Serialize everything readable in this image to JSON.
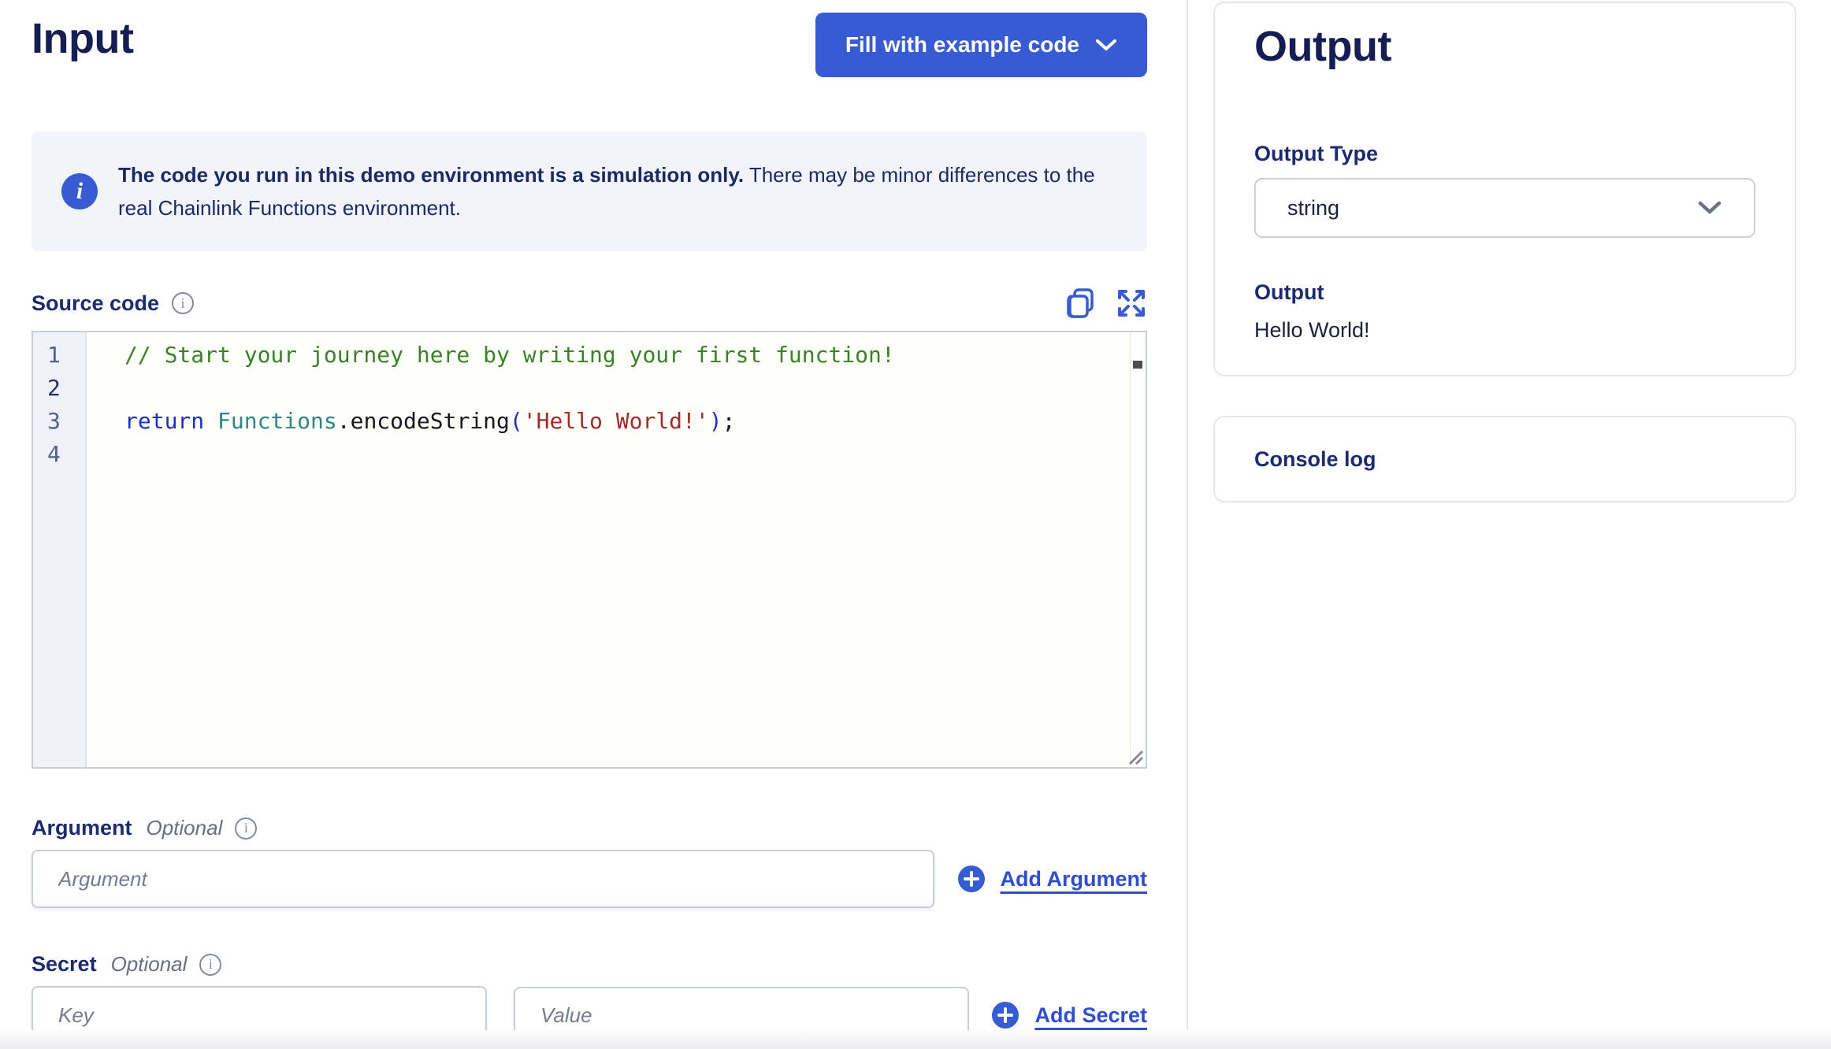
{
  "colors": {
    "accent_blue": "#375BD2",
    "link_blue": "#2E4DD0",
    "heading_navy": "#161D52",
    "label_navy": "#1C2A6E",
    "banner_bg": "#F2F4FA",
    "code_token_colors": {
      "comment": "#3C802B",
      "keyword": "#1E2FC5",
      "type": "#2E8587",
      "plain": "#16161F",
      "string": "#A32A2A"
    },
    "line_number": "#51608C",
    "line_number_active": "#24305F"
  },
  "icons": {
    "banner_info": "info-icon",
    "copy": "copy-icon",
    "expand": "expand-icon",
    "chevron": "chevron-down-icon",
    "plus": "plus-icon",
    "resize": "resize-handle-icon"
  },
  "input_panel": {
    "title": "Input",
    "fill_button_label": "Fill with example code",
    "banner": {
      "bold_text": "The code you run in this demo environment is a simulation only.",
      "regular_text": "There may be minor differences to the real Chainlink Functions environment."
    },
    "source_code": {
      "label": "Source code",
      "active_line": 2,
      "lines": [
        {
          "num": 1,
          "tokens": [
            {
              "text": "// Start your journey here by writing your first function!",
              "type": "comment"
            }
          ]
        },
        {
          "num": 2,
          "tokens": []
        },
        {
          "num": 3,
          "tokens": [
            {
              "text": "return",
              "type": "keyword"
            },
            {
              "text": " ",
              "type": "plain"
            },
            {
              "text": "Functions",
              "type": "type"
            },
            {
              "text": ".encodeString",
              "type": "plain"
            },
            {
              "text": "(",
              "type": "keyword"
            },
            {
              "text": "'Hello World!'",
              "type": "string"
            },
            {
              "text": ")",
              "type": "keyword"
            },
            {
              "text": ";",
              "type": "plain"
            }
          ]
        },
        {
          "num": 4,
          "tokens": []
        }
      ]
    },
    "argument": {
      "label": "Argument",
      "optional_label": "Optional",
      "placeholder": "Argument",
      "add_label": "Add Argument"
    },
    "secret": {
      "label": "Secret",
      "optional_label": "Optional",
      "key_placeholder": "Key",
      "value_placeholder": "Value",
      "add_label": "Add Secret"
    }
  },
  "output_panel": {
    "title": "Output",
    "output_type_label": "Output Type",
    "output_type_value": "string",
    "output_label": "Output",
    "output_value": "Hello World!",
    "console_label": "Console log"
  }
}
